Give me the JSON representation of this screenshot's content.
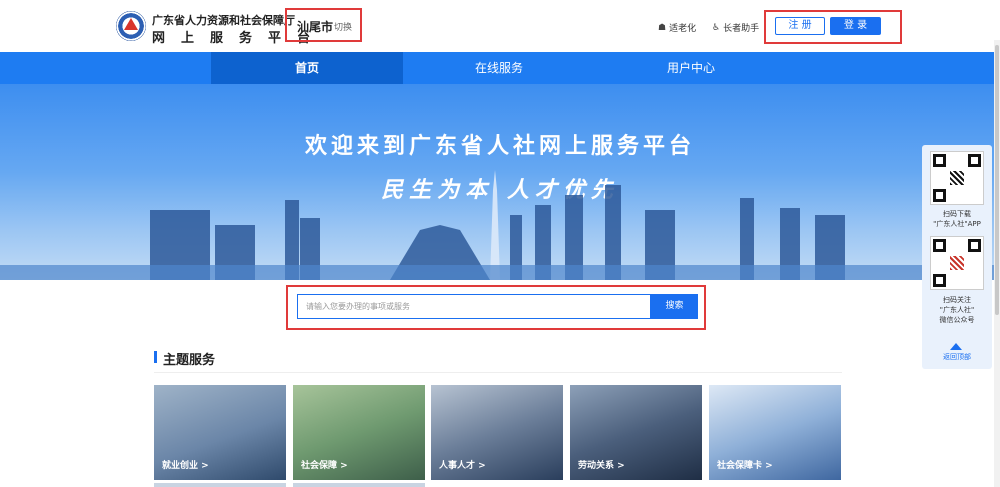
{
  "header": {
    "org_name": "广东省人力资源和社会保障厅",
    "platform_name": "网上服务平台",
    "city": "汕尾市",
    "city_switch": "切换",
    "tools": [
      {
        "label": "适老化",
        "icon": "elderly-mode-icon"
      },
      {
        "label": "长者助手",
        "icon": "accessibility-icon"
      }
    ],
    "register_label": "注 册",
    "login_label": "登 录"
  },
  "nav": {
    "items": [
      {
        "label": "首页",
        "active": true
      },
      {
        "label": "在线服务",
        "active": false
      },
      {
        "label": "用户中心",
        "active": false
      }
    ]
  },
  "banner": {
    "title": "欢迎来到广东省人社网上服务平台",
    "slogan": "民生为本  人才优先"
  },
  "search": {
    "placeholder": "请输入您要办理的事项或服务",
    "button_label": "搜索"
  },
  "section": {
    "title": "主题服务"
  },
  "cards": [
    {
      "label": "就业创业 >",
      "theme": "#3a5a80"
    },
    {
      "label": "社会保障 >",
      "theme": "#4d7a5a"
    },
    {
      "label": "人事人才 >",
      "theme": "#2f4b6e"
    },
    {
      "label": "劳动关系 >",
      "theme": "#2b3f5c"
    },
    {
      "label": "社会保障卡 >",
      "theme": "#4a6a9a"
    }
  ],
  "side_panel": {
    "qr1_text": "扫码下载",
    "qr1_text2": "\"广东人社\"APP",
    "qr2_text": "扫码关注",
    "qr2_text2": "\"广东人社\"",
    "qr2_text3": "微信公众号",
    "back_top": "返回顶部"
  },
  "colors": {
    "primary": "#1a6ff0",
    "nav_bg": "#1e7cf2",
    "highlight_border": "#e03a3a"
  }
}
